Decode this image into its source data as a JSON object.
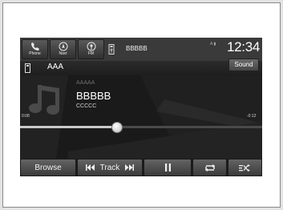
{
  "topbar": {
    "nav": [
      {
        "label": "Phone",
        "icon": "phone-icon"
      },
      {
        "label": "Navi",
        "icon": "navi-icon"
      },
      {
        "label": "FM",
        "icon": "fm-icon"
      }
    ],
    "source_icon": "usb-icon",
    "source_name": "BBBBB",
    "status_small": "A ▮",
    "clock": "12:34"
  },
  "secondbar": {
    "folder": "AAA",
    "sound_label": "Sound"
  },
  "now_playing": {
    "album": "AAAAA",
    "title": "BBBBB",
    "artist": "CCCCC",
    "elapsed": "0:08",
    "remaining": "-0:12",
    "progress": 0.4
  },
  "controls": {
    "browse": "Browse",
    "track": "Track",
    "icons": [
      "skip-back-icon",
      "skip-forward-icon",
      "pause-icon",
      "repeat-icon",
      "shuffle-icon"
    ]
  },
  "colors": {
    "screen_bg": "#1a1a1a",
    "button_top": "#646464",
    "button_bottom": "#3a3a3a",
    "text": "#ffffff"
  }
}
